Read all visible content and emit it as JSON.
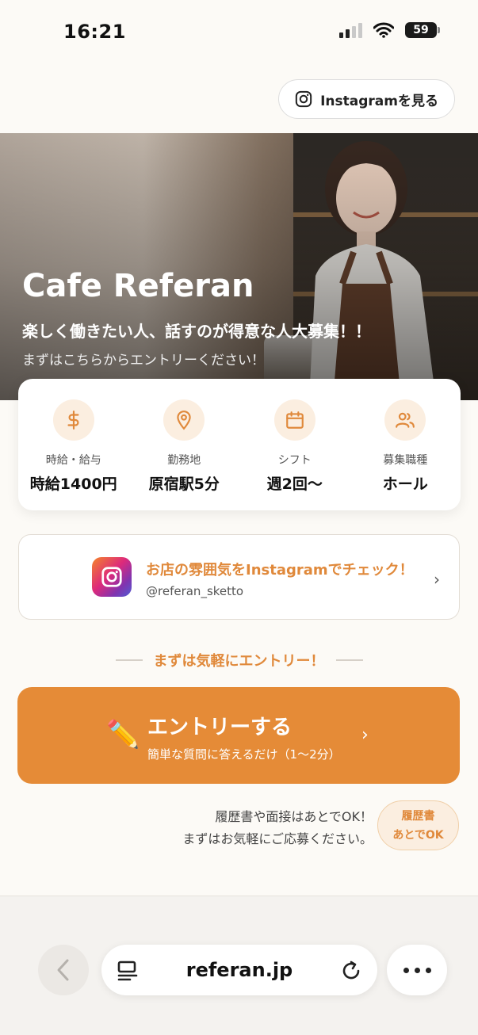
{
  "status_bar": {
    "time": "16:21",
    "battery": "59"
  },
  "header": {
    "instagram_button_label": "Instagramを見る"
  },
  "hero": {
    "title": "Cafe Referan",
    "subtitle": "楽しく働きたい人、話すのが得意な人大募集！！",
    "note": "まずはこちらからエントリーください！"
  },
  "info": {
    "items": [
      {
        "icon": "dollar-icon",
        "label": "時給・給与",
        "value": "時給1400円"
      },
      {
        "icon": "location-pin-icon",
        "label": "勤務地",
        "value": "原宿駅5分"
      },
      {
        "icon": "calendar-icon",
        "label": "シフト",
        "value": "週2回〜"
      },
      {
        "icon": "people-icon",
        "label": "募集職種",
        "value": "ホール"
      }
    ]
  },
  "instagram_card": {
    "title": "お店の雰囲気をInstagramでチェック！",
    "handle": "@referan_sketto"
  },
  "entry": {
    "heading": "まずは気軽にエントリー！",
    "button_label": "エントリーする",
    "button_sub": "簡単な質問に答えるだけ（1〜2分）"
  },
  "reassurance": {
    "line1": "履歴書や面接はあとでOK！",
    "line2": "まずはお気軽にご応募ください。",
    "badge_line1": "履歴書",
    "badge_line2": "あとでOK"
  },
  "browser": {
    "url": "referan.jp"
  },
  "colors": {
    "accent": "#e58b37",
    "accent_text": "#e0893b",
    "icon_bg": "#fbeee0"
  }
}
